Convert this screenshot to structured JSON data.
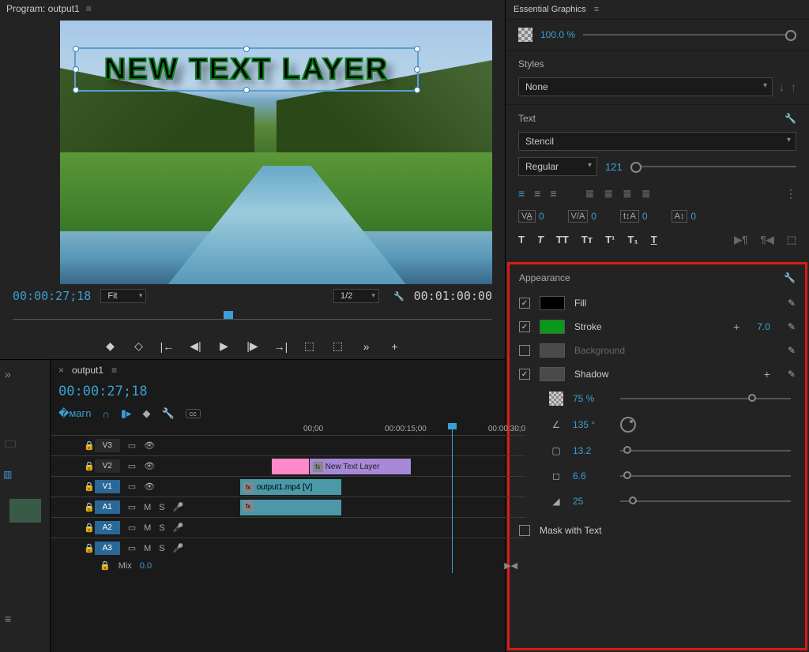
{
  "program": {
    "title": "Program: output1",
    "text_layer": "NEW TEXT LAYER",
    "current_tc": "00:00:27;18",
    "duration_tc": "00:01:00:00",
    "fit_label": "Fit",
    "scale_label": "1/2"
  },
  "sequence": {
    "tab": "output1",
    "tc": "00:00:27;18",
    "ruler": [
      "00;00",
      "00:00:15;00",
      "00:00:30;0"
    ],
    "tracks": {
      "v3": "V3",
      "v2": "V2",
      "v1": "V1",
      "a1": "A1",
      "a2": "A2",
      "a3": "A3",
      "mix": "Mix",
      "mix_val": "0.0"
    },
    "clips": {
      "text": "New Text Layer",
      "video": "output1.mp4 [V]",
      "fx": "fx"
    },
    "meter": {
      "s1": "S",
      "s2": "S"
    }
  },
  "eg": {
    "title": "Essential Graphics",
    "opacity": "100.0 %",
    "styles": {
      "title": "Styles",
      "value": "None"
    },
    "text": {
      "title": "Text",
      "font": "Stencil",
      "weight": "Regular",
      "size": "121",
      "tracking": "0",
      "kerning": "0",
      "leading": "0",
      "baseline": "0"
    },
    "appearance": {
      "title": "Appearance",
      "fill": "Fill",
      "stroke": "Stroke",
      "stroke_val": "7.0",
      "background": "Background",
      "shadow": "Shadow",
      "shadow_opacity": "75 %",
      "shadow_angle": "135 °",
      "shadow_distance": "13.2",
      "shadow_size": "6.6",
      "shadow_blur": "25",
      "mask": "Mask with Text"
    }
  }
}
